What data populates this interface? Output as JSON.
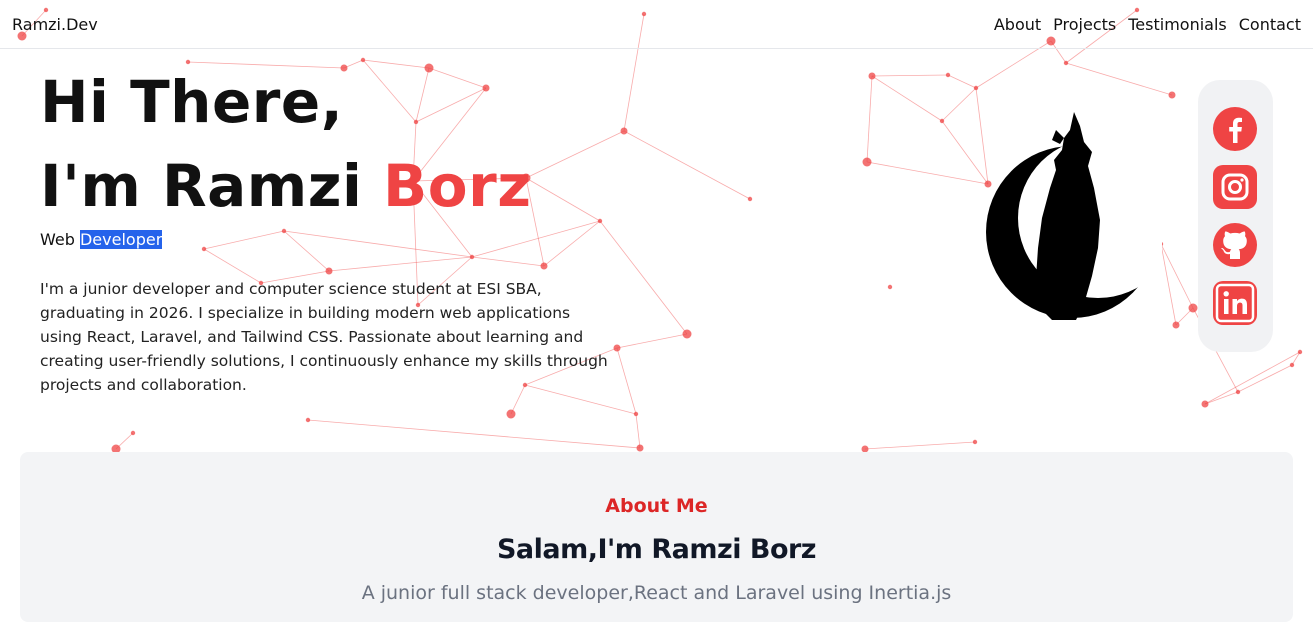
{
  "nav": {
    "brand": "Ramzi.Dev",
    "links": [
      "About",
      "Projects",
      "Testimonials",
      "Contact"
    ]
  },
  "hero": {
    "greeting": "Hi There,",
    "name_prefix": "I'm Ramzi",
    "name_accent": "Borz",
    "role_prefix": "Web",
    "role_highlight": "Developer",
    "bio": "I'm a junior developer and computer science student at ESI SBA, graduating in 2026. I specialize in building modern web applications using React, Laravel, and Tailwind CSS. Passionate about learning and creating user-friendly solutions, I continuously enhance my skills through projects and collaboration."
  },
  "social": [
    "facebook-icon",
    "instagram-icon",
    "github-icon",
    "linkedin-icon"
  ],
  "about": {
    "kicker": "About Me",
    "title": "Salam,I'm Ramzi Borz",
    "subtitle": "A junior full stack developer,React and Laravel using Inertia.js"
  },
  "colors": {
    "accent": "#ef4444",
    "highlight": "#2563eb",
    "panel": "#f3f4f6"
  }
}
